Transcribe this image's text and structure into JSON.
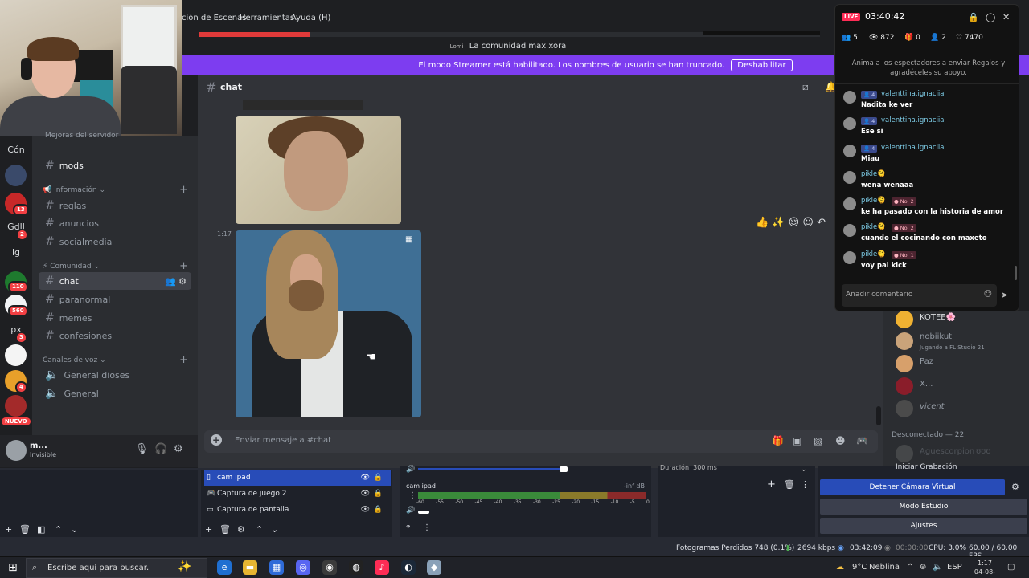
{
  "menubar": {
    "items": [
      "ción de Escenas",
      "Herramientas",
      "Ayuda (H)"
    ]
  },
  "server_title": {
    "logo_text": "Lomi",
    "text": "La comunidad max xora"
  },
  "streamer_banner": {
    "message": "El modo Streamer está habilitado. Los nombres de usuario se han truncado.",
    "button": "Deshabilitar"
  },
  "server_rail": {
    "items": [
      {
        "label": "Cón"
      },
      {
        "label": "GdlJ",
        "badge": "2"
      },
      {
        "label": "ig"
      },
      {
        "label": "px",
        "badge": "3"
      }
    ],
    "badges": [
      "13",
      "110",
      "560",
      "4"
    ],
    "new_label": "NUEVO"
  },
  "channels": {
    "partial_top": "Mejoras del servidor",
    "mods": "mods",
    "categories": [
      "Información",
      "Comunidad",
      "Canales de voz"
    ],
    "info_channels": [
      "reglas",
      "anuncios",
      "socialmedia"
    ],
    "community_channels": [
      "chat",
      "paranormal",
      "memes",
      "confesiones"
    ],
    "voice_channels": [
      "General dioses",
      "General"
    ]
  },
  "user_panel": {
    "name": "m...",
    "status": "Invisible"
  },
  "chat": {
    "channel": "chat",
    "timestamp": "1:17",
    "input_placeholder": "Enviar mensaje a #chat"
  },
  "members": {
    "items": [
      {
        "name": "KOTEE🌸",
        "activity": "",
        "color": "#f0b232"
      },
      {
        "name": "nobiikut",
        "activity": "Jugando a FL Studio 21",
        "color": "#c9a37a"
      },
      {
        "name": "Paz",
        "activity": "",
        "color": "#d7a06b"
      },
      {
        "name": "X...",
        "activity": "",
        "color": "#8a1d2a"
      },
      {
        "name": "vicent",
        "activity": "",
        "color": "#4b4b4b"
      }
    ],
    "offline_header": "Desconectado — 22",
    "offline_first": "Aguescorpion",
    "offline_first_extra": "ʊʊʊ"
  },
  "live": {
    "badge": "LIVE",
    "timer": "03:40:42",
    "stats": [
      "5",
      "872",
      "0",
      "2",
      "7470"
    ],
    "hint": "Anima a los espectadores a enviar Regalos y agradéceles su apoyo.",
    "comments": [
      {
        "user": "valenttina.ignaciia",
        "level": "4",
        "tag": "",
        "text": "Nadita ke ver"
      },
      {
        "user": "valenttina.ignaciia",
        "level": "4",
        "tag": "",
        "text": "Ese si"
      },
      {
        "user": "valenttina.ignaciia",
        "level": "4",
        "tag": "",
        "text": "Miau"
      },
      {
        "user": "pikle🫠",
        "level": "",
        "tag": "",
        "text": "wena wenaaa"
      },
      {
        "user": "pikle🫠",
        "level": "",
        "tag": "No. 2",
        "text": "ke ha pasado con la historia de amor"
      },
      {
        "user": "pikle🫠",
        "level": "",
        "tag": "No. 2",
        "text": "cuando el cocinando con maxeto"
      },
      {
        "user": "pikle🫠",
        "level": "",
        "tag": "No. 1",
        "text": "voy pal kick"
      }
    ],
    "input_placeholder": "Añadir comentario"
  },
  "obs": {
    "sources": [
      "cam ipad",
      "Captura de juego 2",
      "Captura de pantalla"
    ],
    "mixer": {
      "source": "cam ipad",
      "db": "-inf dB",
      "ticks": [
        "-60",
        "-55",
        "-50",
        "-45",
        "-40",
        "-35",
        "-30",
        "-25",
        "-20",
        "-15",
        "-10",
        "-5",
        "0"
      ]
    },
    "transition": {
      "duration_label": "Duración",
      "duration_value": "300 ms"
    },
    "controls": {
      "record_partial": "Iniciar Grabación",
      "virtual_cam": "Detener Cámara Virtual",
      "studio": "Modo Estudio",
      "settings": "Ajustes"
    },
    "status": {
      "dropped": "Fotogramas Perdidos 748 (0.1%)",
      "bitrate": "2694 kbps",
      "live_time": "03:42:09",
      "rec_time": "00:00:00",
      "cpu": "CPU: 3.0%",
      "fps": "60.00 / 60.00 FPS"
    }
  },
  "taskbar": {
    "search_placeholder": "Escribe aquí para buscar.",
    "weather": "9°C",
    "weather_desc": "Neblina",
    "lang": "ESP",
    "time": "1:17",
    "date": "04-08-2025"
  }
}
